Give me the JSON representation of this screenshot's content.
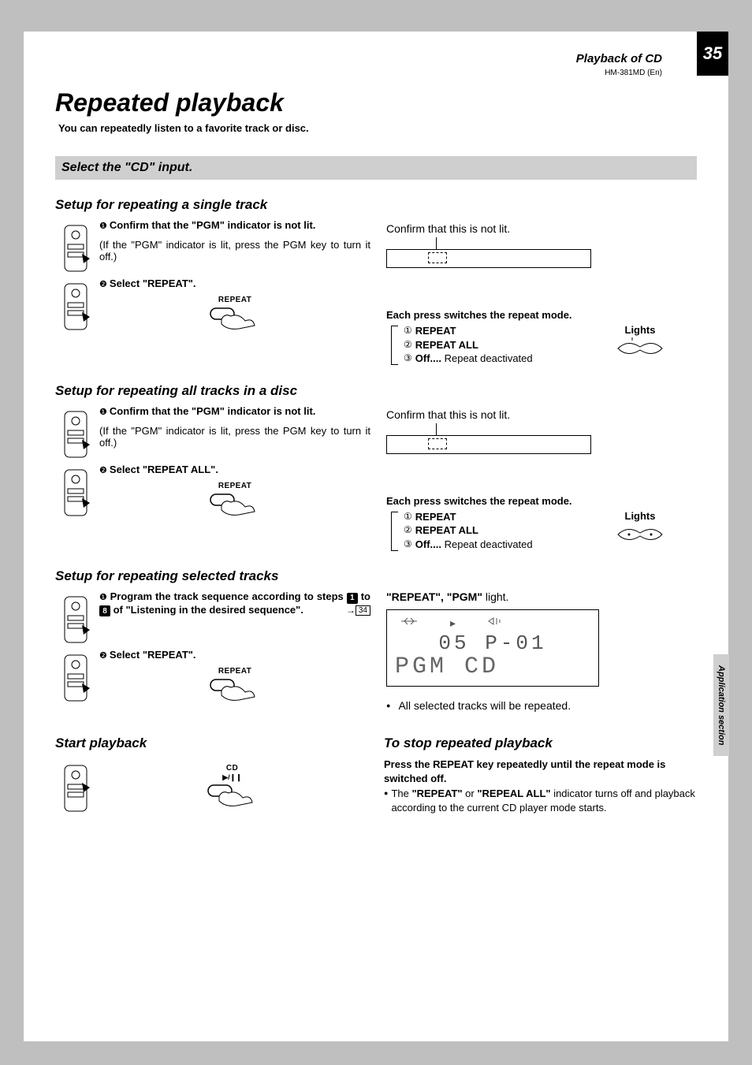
{
  "header": {
    "section": "Playback of CD",
    "page_number": "35",
    "model": "HM-381MD (En)"
  },
  "title": "Repeated playback",
  "intro": "You can repeatedly listen to a favorite track or disc.",
  "select_bar": "Select the \"CD\" input.",
  "side_tab": "Application section",
  "section1": {
    "heading": "Setup for repeating a single track",
    "step1_bold": "Confirm that the \"PGM\" indicator is not lit.",
    "step1_note": "(If the \"PGM\" indicator is lit, press the PGM key to turn it off.)",
    "step2_bold": "Select \"REPEAT\".",
    "btn_label": "REPEAT",
    "confirm_line": "Confirm that this is not lit.",
    "mode_head": "Each press switches the repeat mode.",
    "modes": {
      "m1": "REPEAT",
      "m2": "REPEAT ALL",
      "m3_pre": "Off....",
      "m3_rest": " Repeat deactivated"
    },
    "lights_label": "Lights"
  },
  "section2": {
    "heading": "Setup for repeating all tracks in a disc",
    "step1_bold": "Confirm that the \"PGM\" indicator is not lit.",
    "step1_note": "(If the \"PGM\" indicator is lit, press the PGM key to turn it off.)",
    "step2_bold": "Select \"REPEAT ALL\".",
    "btn_label": "REPEAT",
    "confirm_line": "Confirm that this is not lit.",
    "mode_head": "Each press switches the repeat mode.",
    "modes": {
      "m1": "REPEAT",
      "m2": "REPEAT ALL",
      "m3_pre": "Off....",
      "m3_rest": " Repeat deactivated"
    },
    "lights_label": "Lights"
  },
  "section3": {
    "heading": "Setup for repeating selected tracks",
    "step1_pre": "Program the track sequence according to steps ",
    "step1_mid": " to ",
    "step1_post": " of \"Listening in the desired sequence\".",
    "step1_n1": "1",
    "step1_n2": "8",
    "page_ref": "34",
    "step2_bold": "Select \"REPEAT\".",
    "btn_label": "REPEAT",
    "right_head_pre": "\"REPEAT\", \"PGM\"",
    "right_head_post": " light.",
    "display_line1": "05  P-01",
    "display_line2": "PGM  CD",
    "bullet": "All selected tracks will be repeated."
  },
  "start": {
    "heading": "Start playback",
    "btn_label": "CD",
    "btn_sym": "▶/❙❙"
  },
  "stop": {
    "heading": "To stop repeated playback",
    "line1": "Press the REPEAT key repeatedly until the repeat mode is switched off.",
    "bullet_pre": "The ",
    "bullet_b1": "\"REPEAT\"",
    "bullet_mid": " or ",
    "bullet_b2": "\"REPEAL ALL\"",
    "bullet_post": " indicator turns off and playback according to the current CD player mode starts."
  }
}
